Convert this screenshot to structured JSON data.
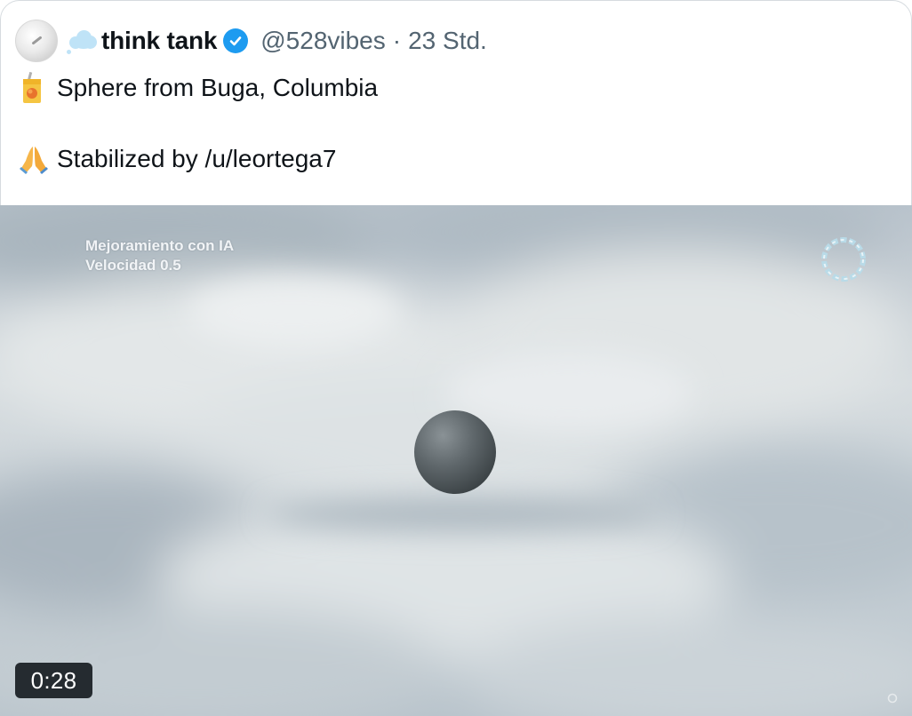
{
  "tweet": {
    "display_name": "think tank",
    "handle": "@528vibes",
    "separator": "·",
    "time": "23 Std.",
    "line1_emoji": "juice-box-emoji",
    "line1_text": "Sphere from Buga, Columbia",
    "line2_emoji": "folded-hands-emoji",
    "line2_text": "Stabilized by /u/leortega7"
  },
  "video": {
    "overlay_line1": "Mejoramiento con IA",
    "overlay_line2": "Velocidad 0.5",
    "duration": "0:28"
  },
  "colors": {
    "verified_blue": "#1d9bf0",
    "secondary_text": "#536471",
    "primary_text": "#0f1419"
  }
}
